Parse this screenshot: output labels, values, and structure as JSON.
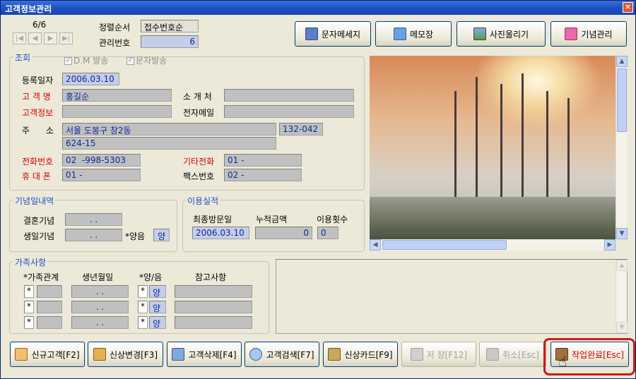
{
  "window": {
    "title": "고객정보관리",
    "close": "×"
  },
  "record": {
    "counter": "6/6",
    "sort_label": "정렬순서",
    "sort_value": "접수번호순",
    "id_label": "관리번호",
    "id_value": "6"
  },
  "nav": [
    "|◀",
    "◀",
    "▶",
    "▶|"
  ],
  "top_buttons": {
    "sms": "문자메세지",
    "memo": "메모장",
    "photo": "사진올리기",
    "anniv": "기념관리"
  },
  "lookup": {
    "title": "조회",
    "dm_check": "D.M 발송",
    "sms_check": "문자발송",
    "reg_date_label": "등록일자",
    "reg_date": "2006.03.10",
    "name_label": "고 객 명",
    "name": "홍길순",
    "referrer_label": "소 개 처",
    "referrer": "",
    "info_label": "고객정보",
    "info": "",
    "email_label": "전자메일",
    "email": "",
    "address_label": "주      소",
    "address1": "서울 도봉구 창2동",
    "zip": "132-042",
    "address2": "624-15",
    "phone_label": "전화번호",
    "phone": "02  -998-5303",
    "other_phone_label": "기타전화",
    "other_phone": "01 -",
    "mobile_label": "휴 대 폰",
    "mobile": "01 -",
    "fax_label": "팩스번호",
    "fax": "02 -"
  },
  "anniversary": {
    "title": "기념일내역",
    "wedding_label": "결혼기념",
    "wedding": ". .",
    "birthday_label": "생일기념",
    "birthday": ". .",
    "calendar_label": "*양음",
    "calendar": "양"
  },
  "usage": {
    "title": "이용실적",
    "last_visit_label": "최종방문일",
    "last_visit": "2006.03.10",
    "total_label": "누적금액",
    "total": "0",
    "count_label": "이용횟수",
    "count": "0"
  },
  "family": {
    "title": "가족사항",
    "headers": [
      "*가족관계",
      "생년월일",
      "*양/음",
      "참고사항"
    ],
    "rows": [
      {
        "star": "*",
        "relation": "",
        "birth": ". .",
        "star2": "*",
        "cal": "양",
        "note": ""
      },
      {
        "star": "*",
        "relation": "",
        "birth": ". .",
        "star2": "*",
        "cal": "양",
        "note": ""
      },
      {
        "star": "*",
        "relation": "",
        "birth": ". .",
        "star2": "*",
        "cal": "양",
        "note": ""
      }
    ]
  },
  "bottom_buttons": {
    "new": "신규고객[F2]",
    "change": "신상변경[F3]",
    "delete": "고객삭제[F4]",
    "search": "고객검색[F7]",
    "card": "신상카드[F9]",
    "save": "저 장[F12]",
    "cancel": "취소[Esc]",
    "done": "작업완료[Esc]"
  },
  "colors": {
    "title_bar": "#1c52c6",
    "field_text": "#0a2a9a",
    "required_label": "#d40000",
    "highlight": "#d01818"
  }
}
